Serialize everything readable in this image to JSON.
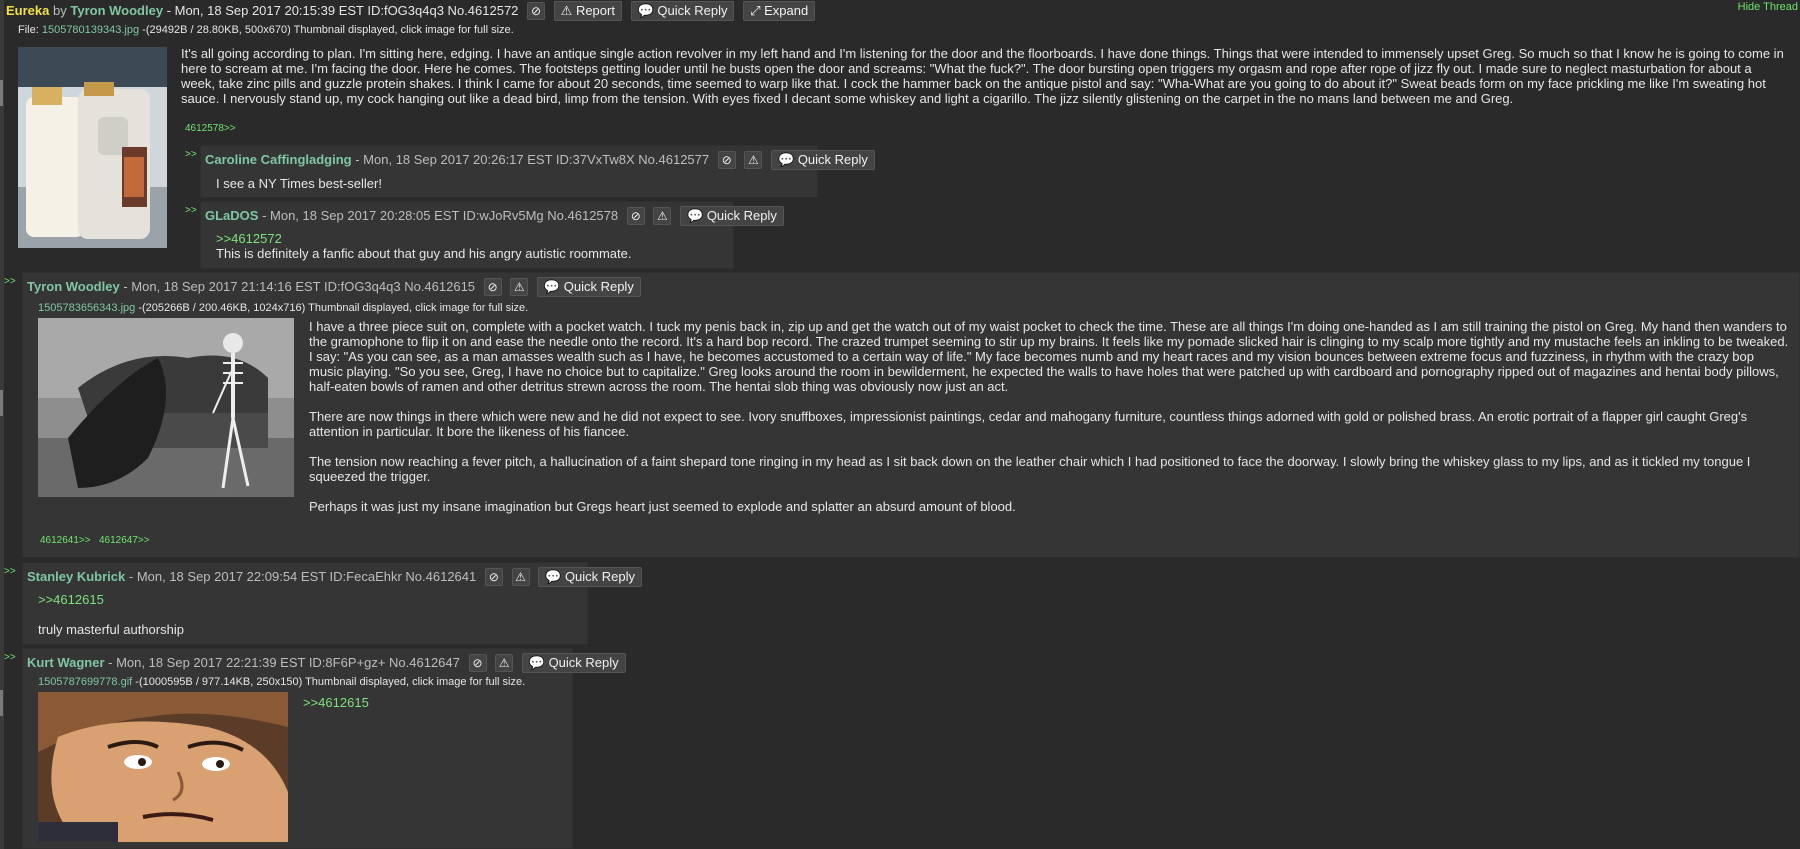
{
  "op": {
    "subject": "Eureka",
    "by": "by",
    "name": "Tyron Woodley",
    "meta": " - Mon, 18 Sep 2017 20:15:39 EST ID:fOG3q4q3 No.4612572",
    "file_label": "File: ",
    "file_name": "1505780139343.jpg",
    "file_info": " -(29492B / 28.80KB, 500x670) Thumbnail displayed, click image for full size.",
    "text": "It's all going according to plan. I'm sitting here, edging. I have an antique single action revolver in my left hand and I'm listening for the door and the floorboards. I have done things. Things that were intended to immensely upset Greg. So much so that I know he is going to come in here to scream at me. I'm facing the door. Here he comes. The footsteps getting louder until he busts open the door and screams: \"What the fuck?\". The door bursting open triggers my orgasm and rope after rope of jizz fly out. I made sure to neglect masturbation for about a week, take zinc pills and guzzle protein shakes. I think I came for about 20 seconds, time seemed to warp like that. I cock the hammer back on the antique pistol and say: \"Wha-What are you going to do about it?\" Sweat beads form on my face prickling me like I'm sweating hot sauce. I nervously stand up, my cock hanging out like a dead bird, limp from the tension. With eyes fixed I decant some whiskey and light a cigarillo. The jizz silently glistening on the carpet in the no mans land between me and Greg.",
    "backlinks": "4612578>>",
    "hide_label": "Hide Thread"
  },
  "buttons": {
    "report": "Report",
    "quick_reply": "Quick Reply",
    "expand": "Expand"
  },
  "replies": [
    {
      "arrow": ">>",
      "name": "Caroline Caffingladging",
      "meta": " - Mon, 18 Sep 2017 20:26:17 EST ID:37VxTw8X No.4612577",
      "text": "I see a NY Times best-seller!"
    },
    {
      "arrow": ">>",
      "name": "GLaDOS",
      "meta": " - Mon, 18 Sep 2017 20:28:05 EST ID:wJoRv5Mg No.4612578",
      "quote": ">>4612572",
      "text": "This is definitely a fanfic about that guy and his angry autistic roommate."
    },
    {
      "arrow": ">>",
      "name": "Tyron Woodley",
      "meta": " - Mon, 18 Sep 2017 21:14:16 EST ID:fOG3q4q3 No.4612615",
      "file_name": "1505783656343.jpg",
      "file_info": " -(205266B / 200.46KB, 1024x716) Thumbnail displayed, click image for full size.",
      "paragraphs": [
        "I have a three piece suit on, complete with a pocket watch. I tuck my penis back in, zip up and get the watch out of my waist pocket to check the time. These are all things I'm doing one-handed as I am still training the pistol on Greg. My hand then wanders to the gramophone to flip it on and ease the needle onto the record. It's a hard bop record. The crazed trumpet seeming to stir up my brains. It feels like my pomade slicked hair is clinging to my scalp more tightly and my mustache feels an inkling to be tweaked. I say: \"As you can see, as a man amasses wealth such as I have, he becomes accustomed to a certain way of life.\" My face becomes numb and my heart races and my vision bounces between extreme focus and fuzziness, in rhythm with the crazy bop music playing. \"So you see, Greg, I have no choice but to capitalize.\" Greg looks around the room in bewilderment, he expected the walls to have holes that were patched up with cardboard and pornography ripped out of magazines and hentai body pillows, half-eaten bowls of ramen and other detritus strewn across the room. The hentai slob thing was obviously now just an act.",
        "There are now things in there which were new and he did not expect to see. Ivory snuffboxes, impressionist paintings, cedar and mahogany furniture, countless things adorned with gold or polished brass. An erotic portrait of a flapper girl caught Greg's attention in particular. It bore the likeness of his fiancee.",
        "The tension now reaching a fever pitch, a hallucination of a faint shepard tone ringing in my head as I sit back down on the leather chair which I had positioned to face the doorway. I slowly bring the whiskey glass to my lips, and as it tickled my tongue I squeezed the trigger.",
        "Perhaps it was just my insane imagination but Gregs heart just seemed to explode and splatter an absurd amount of blood."
      ],
      "backlink1": "4612641>>",
      "backlink2": "4612647>>"
    },
    {
      "arrow": ">>",
      "name": "Stanley Kubrick",
      "meta": " - Mon, 18 Sep 2017 22:09:54 EST ID:FecaEhkr No.4612641",
      "quote": ">>4612615",
      "text": "truly masterful authorship"
    },
    {
      "arrow": ">>",
      "name": "Kurt Wagner",
      "meta": " - Mon, 18 Sep 2017 22:21:39 EST ID:8F6P+gz+ No.4612647",
      "file_name": "1505787699778.gif",
      "file_info": " -(1000595B / 977.14KB, 250x150) Thumbnail displayed, click image for full size.",
      "quote": ">>4612615"
    }
  ],
  "icons": {
    "hide": "⊘",
    "warn": "⚠",
    "reply": "💬",
    "expand": "⤢",
    "report": "⚠"
  },
  "colors": {
    "background": "#2a2a2a",
    "post": "#353535",
    "name": "#55c07a",
    "subject": "#f0e14a",
    "quote": "#7fe07f"
  }
}
